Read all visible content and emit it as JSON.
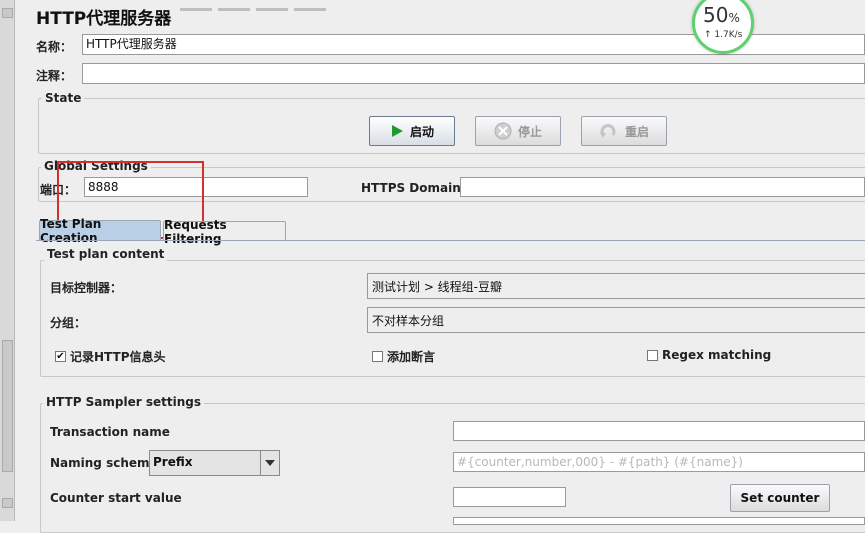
{
  "title": "HTTP代理服务器",
  "name_label": "名称：",
  "name_value": "HTTP代理服务器",
  "comment_label": "注释：",
  "comment_value": "",
  "state": {
    "legend": "State",
    "start_label": "启动",
    "stop_label": "停止",
    "restart_label": "重启"
  },
  "global": {
    "legend": "Global Settings",
    "port_label": "端口：",
    "port_value": "8888",
    "https_label": "HTTPS Domains:",
    "https_value": ""
  },
  "tabs": [
    {
      "label": "Test Plan Creation",
      "active": true
    },
    {
      "label": "Requests Filtering",
      "active": false
    }
  ],
  "content": {
    "legend": "Test plan content",
    "target_label": "目标控制器：",
    "target_value": "测试计划 > 线程组-豆瓣",
    "group_label": "分组：",
    "group_value": "不对样本分组",
    "record_headers_label": "记录HTTP信息头",
    "record_headers_checked": true,
    "add_assertion_label": "添加断言",
    "add_assertion_checked": false,
    "regex_label": "Regex matching",
    "regex_checked": false
  },
  "sampler": {
    "legend": "HTTP Sampler settings",
    "transaction_label": "Transaction name",
    "transaction_value": "",
    "naming_label": "Naming scheme",
    "naming_value": "Prefix",
    "naming_format_placeholder": "#{counter,number,000} - #{path} (#{name})",
    "counter_label": "Counter start value",
    "counter_value": "",
    "set_counter_label": "Set counter"
  },
  "net_badge": {
    "percent": "50",
    "percent_sign": "%",
    "speed": "↑ 1.7K/s",
    "ring_color": "#5fd16c"
  }
}
